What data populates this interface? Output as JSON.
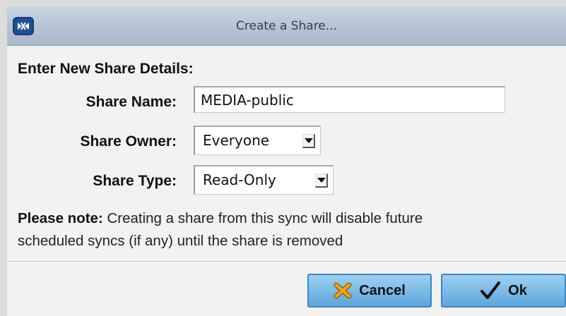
{
  "window": {
    "title": "Create a Share...",
    "icon": "app-logo-icon"
  },
  "form": {
    "heading": "Enter New Share Details:",
    "share_name": {
      "label": "Share Name:",
      "value": "MEDIA-public"
    },
    "share_owner": {
      "label": "Share Owner:",
      "value": "Everyone"
    },
    "share_type": {
      "label": "Share Type:",
      "value": "Read-Only"
    }
  },
  "note": {
    "bold": "Please note:",
    "line1": " Creating a share from this sync will disable future",
    "line2": "scheduled syncs (if any) until the share is removed"
  },
  "buttons": {
    "cancel": {
      "label": "Cancel",
      "icon": "x-cross-icon"
    },
    "ok": {
      "label": "Ok",
      "icon": "checkmark-icon"
    }
  },
  "colors": {
    "titlebar": "#b6c3d3",
    "button": "#7dbbe8",
    "cancel_icon": "#f0a21b"
  }
}
